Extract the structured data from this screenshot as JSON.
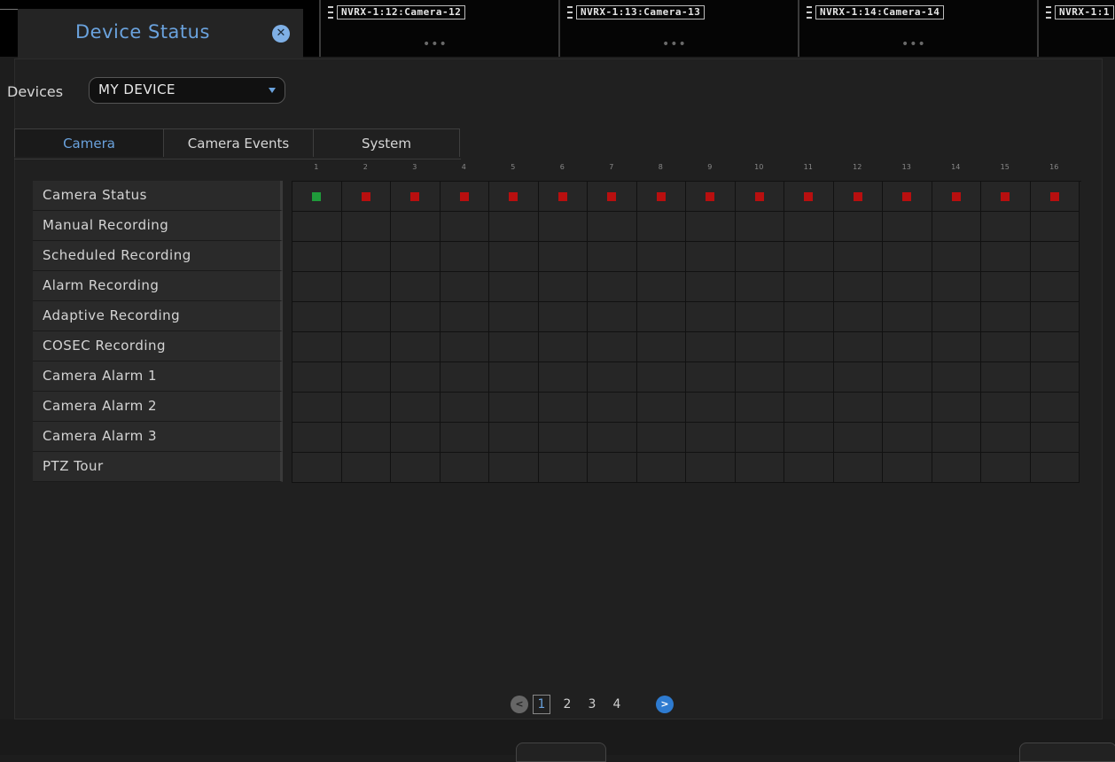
{
  "panel": {
    "title": "Device Status"
  },
  "devices": {
    "label": "Devices",
    "value": "MY DEVICE"
  },
  "tabs": [
    "Camera",
    "Camera Events",
    "System"
  ],
  "active_tab": "Camera",
  "column_numbers": [
    "1",
    "2",
    "3",
    "4",
    "5",
    "6",
    "7",
    "8",
    "9",
    "10",
    "11",
    "12",
    "13",
    "14",
    "15",
    "16"
  ],
  "rows": [
    "Camera Status",
    "Manual Recording",
    "Scheduled Recording",
    "Alarm Recording",
    "Adaptive Recording",
    "COSEC Recording",
    "Camera Alarm 1",
    "Camera Alarm 2",
    "Camera Alarm 3",
    "PTZ Tour"
  ],
  "camera_status": [
    "green",
    "red",
    "red",
    "red",
    "red",
    "red",
    "red",
    "red",
    "red",
    "red",
    "red",
    "red",
    "red",
    "red",
    "red",
    "red"
  ],
  "status_colors": {
    "green": "#1f9a3a",
    "red": "#b80f0f"
  },
  "camera_tiles": [
    "NVRX-1:12:Camera-12",
    "NVRX-1:13:Camera-13",
    "NVRX-1:14:Camera-14",
    "NVRX-1:1"
  ],
  "pagination": {
    "pages": [
      "1",
      "2",
      "3",
      "4"
    ],
    "current": "1"
  },
  "accent": "#6aa2dd"
}
